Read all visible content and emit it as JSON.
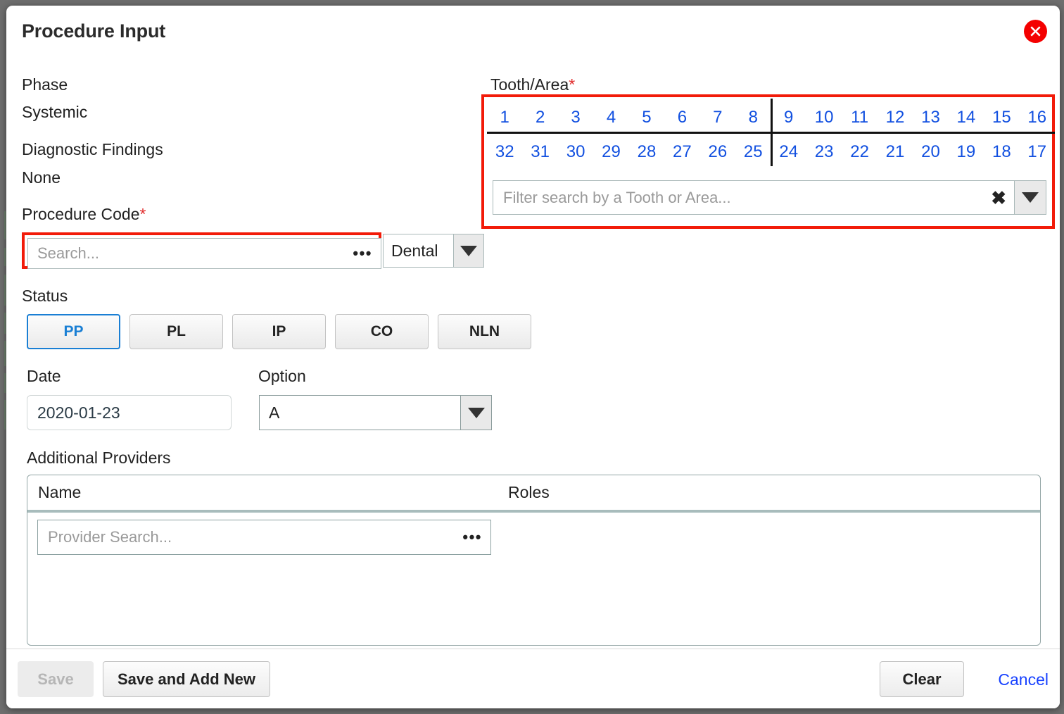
{
  "dialog": {
    "title": "Procedure Input",
    "close_icon": "close-circle-icon"
  },
  "left": {
    "phase_label": "Phase",
    "phase_value": "Systemic",
    "findings_label": "Diagnostic Findings",
    "findings_value": "None",
    "procedure_code_label": "Procedure Code",
    "required_mark": "*",
    "procedure_code_placeholder": "Search...",
    "procedure_code_value": "",
    "ellipsis_label": "•••",
    "code_type_value": "Dental"
  },
  "status": {
    "label": "Status",
    "buttons": [
      {
        "label": "PP",
        "selected": true
      },
      {
        "label": "PL",
        "selected": false
      },
      {
        "label": "IP",
        "selected": false
      },
      {
        "label": "CO",
        "selected": false
      },
      {
        "label": "NLN",
        "selected": false
      }
    ]
  },
  "date": {
    "label": "Date",
    "value": "2020-01-23"
  },
  "option": {
    "label": "Option",
    "value": "A"
  },
  "providers": {
    "label": "Additional Providers",
    "columns": [
      "Name",
      "Roles"
    ],
    "search_placeholder": "Provider Search...",
    "search_value": "",
    "ellipsis_label": "•••",
    "rows": []
  },
  "tooth": {
    "label": "Tooth/Area",
    "required_mark": "*",
    "upper_right": [
      "1",
      "2",
      "3",
      "4",
      "5",
      "6",
      "7",
      "8"
    ],
    "upper_left": [
      "9",
      "10",
      "11",
      "12",
      "13",
      "14",
      "15",
      "16"
    ],
    "lower_right": [
      "32",
      "31",
      "30",
      "29",
      "28",
      "27",
      "26",
      "25"
    ],
    "lower_left": [
      "24",
      "23",
      "22",
      "21",
      "20",
      "19",
      "18",
      "17"
    ],
    "filter_placeholder": "Filter search by a Tooth or Area...",
    "filter_value": "",
    "clear_icon_label": "✖"
  },
  "footer": {
    "save_label": "Save",
    "save_add_new_label": "Save and Add New",
    "clear_label": "Clear",
    "cancel_label": "Cancel"
  },
  "colors": {
    "highlight": "#f21b09",
    "accent_blue": "#1a7fd4",
    "tooth_blue": "#1250e0",
    "link_blue": "#1741ff",
    "required_red": "#e02a2a",
    "close_red": "#f40000"
  }
}
